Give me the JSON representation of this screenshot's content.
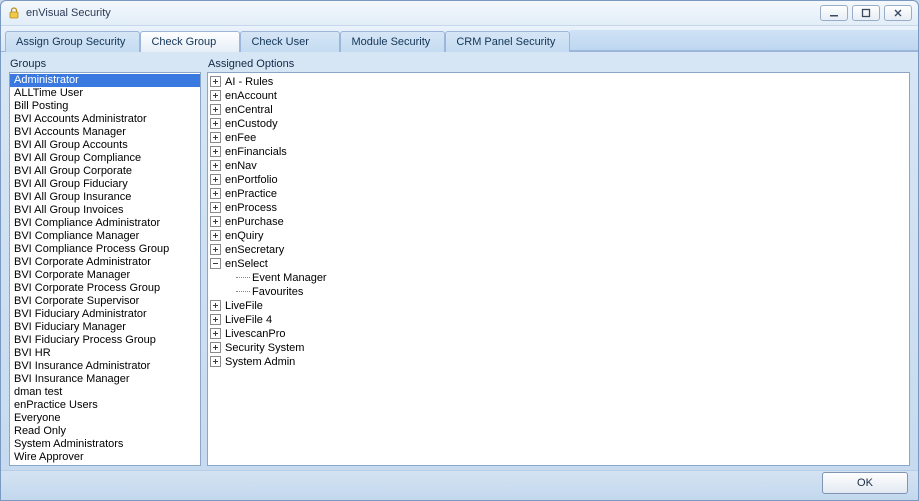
{
  "window": {
    "title": "enVisual Security"
  },
  "tabs": [
    {
      "label": "Assign Group Security",
      "state": "inactive"
    },
    {
      "label": "Check Group",
      "state": "active"
    },
    {
      "label": "Check User",
      "state": "inactive"
    },
    {
      "label": "Module Security",
      "state": "inactive"
    },
    {
      "label": "CRM Panel Security",
      "state": "inactive"
    }
  ],
  "groups": {
    "label": "Groups",
    "selected_index": 0,
    "items": [
      "Administrator",
      "ALLTime User",
      "Bill Posting",
      "BVI Accounts Administrator",
      "BVI Accounts Manager",
      "BVI All Group Accounts",
      "BVI All Group Compliance",
      "BVI All Group Corporate",
      "BVI All Group Fiduciary",
      "BVI All Group Insurance",
      "BVI All Group Invoices",
      "BVI Compliance Administrator",
      "BVI Compliance Manager",
      "BVI Compliance Process Group",
      "BVI Corporate Administrator",
      "BVI Corporate Manager",
      "BVI Corporate Process Group",
      "BVI Corporate Supervisor",
      "BVI Fiduciary Administrator",
      "BVI Fiduciary Manager",
      "BVI Fiduciary Process Group",
      "BVI HR",
      "BVI Insurance Administrator",
      "BVI Insurance Manager",
      "dman test",
      "enPractice Users",
      "Everyone",
      "Read Only",
      "System Administrators",
      "Wire Approver"
    ]
  },
  "assigned": {
    "label": "Assigned Options",
    "nodes": [
      {
        "label": "AI - Rules",
        "state": "collapsed"
      },
      {
        "label": "enAccount",
        "state": "collapsed"
      },
      {
        "label": "enCentral",
        "state": "collapsed"
      },
      {
        "label": "enCustody",
        "state": "collapsed"
      },
      {
        "label": "enFee",
        "state": "collapsed"
      },
      {
        "label": "enFinancials",
        "state": "collapsed"
      },
      {
        "label": "enNav",
        "state": "collapsed"
      },
      {
        "label": "enPortfolio",
        "state": "collapsed"
      },
      {
        "label": "enPractice",
        "state": "collapsed"
      },
      {
        "label": "enProcess",
        "state": "collapsed"
      },
      {
        "label": "enPurchase",
        "state": "collapsed"
      },
      {
        "label": "enQuiry",
        "state": "collapsed"
      },
      {
        "label": "enSecretary",
        "state": "collapsed"
      },
      {
        "label": "enSelect",
        "state": "expanded",
        "children": [
          {
            "label": "Event Manager"
          },
          {
            "label": "Favourites"
          }
        ]
      },
      {
        "label": "LiveFile",
        "state": "collapsed"
      },
      {
        "label": "LiveFile 4",
        "state": "collapsed"
      },
      {
        "label": "LivescanPro",
        "state": "collapsed"
      },
      {
        "label": "Security System",
        "state": "collapsed"
      },
      {
        "label": "System Admin",
        "state": "collapsed"
      }
    ]
  },
  "footer": {
    "ok_label": "OK"
  }
}
